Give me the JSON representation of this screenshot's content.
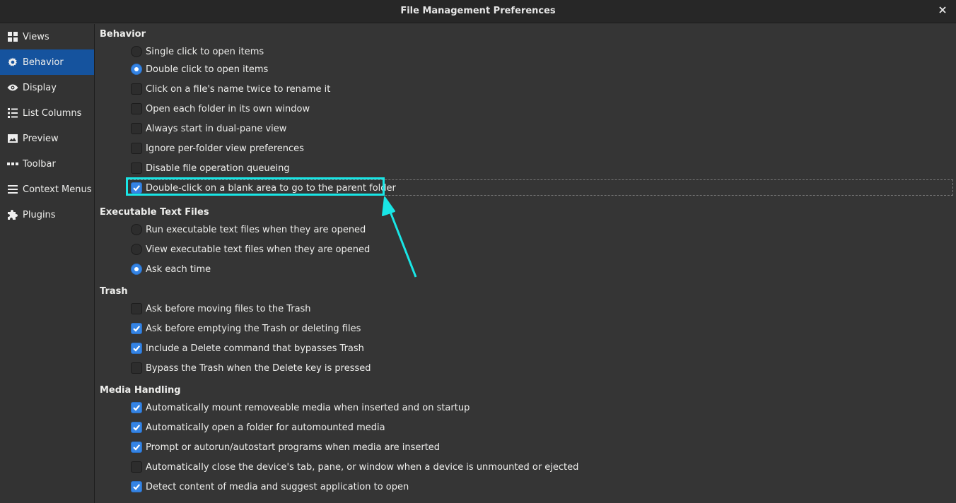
{
  "window": {
    "title": "File Management Preferences",
    "close_icon": "close-icon"
  },
  "sidebar": {
    "items": [
      {
        "label": "Views",
        "icon": "grid-icon",
        "active": false
      },
      {
        "label": "Behavior",
        "icon": "gear-icon",
        "active": true
      },
      {
        "label": "Display",
        "icon": "eye-icon",
        "active": false
      },
      {
        "label": "List Columns",
        "icon": "list-icon",
        "active": false
      },
      {
        "label": "Preview",
        "icon": "image-icon",
        "active": false
      },
      {
        "label": "Toolbar",
        "icon": "dots-icon",
        "active": false
      },
      {
        "label": "Context Menus",
        "icon": "menu-icon",
        "active": false
      },
      {
        "label": "Plugins",
        "icon": "puzzle-icon",
        "active": false
      }
    ]
  },
  "sections": {
    "behavior": {
      "title": "Behavior",
      "options": [
        {
          "type": "radio",
          "label": "Single click to open items",
          "checked": false
        },
        {
          "type": "radio",
          "label": "Double click to open items",
          "checked": true
        },
        {
          "type": "checkbox",
          "label": "Click on a file's name twice to rename it",
          "checked": false
        },
        {
          "type": "checkbox",
          "label": "Open each folder in its own window",
          "checked": false
        },
        {
          "type": "checkbox",
          "label": "Always start in dual-pane view",
          "checked": false
        },
        {
          "type": "checkbox",
          "label": "Ignore per-folder view preferences",
          "checked": false
        },
        {
          "type": "checkbox",
          "label": "Disable file operation queueing",
          "checked": false
        },
        {
          "type": "checkbox",
          "label": "Double-click on a blank area to go to the parent folder",
          "checked": true
        }
      ]
    },
    "executable": {
      "title": "Executable Text Files",
      "options": [
        {
          "type": "radio",
          "label": "Run executable text files when they are opened",
          "checked": false
        },
        {
          "type": "radio",
          "label": "View executable text files when they are opened",
          "checked": false
        },
        {
          "type": "radio",
          "label": "Ask each time",
          "checked": true
        }
      ]
    },
    "trash": {
      "title": "Trash",
      "options": [
        {
          "type": "checkbox",
          "label": "Ask before moving files to the Trash",
          "checked": false
        },
        {
          "type": "checkbox",
          "label": "Ask before emptying the Trash or deleting files",
          "checked": true
        },
        {
          "type": "checkbox",
          "label": "Include a Delete command that bypasses Trash",
          "checked": true
        },
        {
          "type": "checkbox",
          "label": "Bypass the Trash when the Delete key is pressed",
          "checked": false
        }
      ]
    },
    "media": {
      "title": "Media Handling",
      "options": [
        {
          "type": "checkbox",
          "label": "Automatically mount removeable media when inserted and on startup",
          "checked": true
        },
        {
          "type": "checkbox",
          "label": "Automatically open a folder for automounted media",
          "checked": true
        },
        {
          "type": "checkbox",
          "label": "Prompt or autorun/autostart programs when media are inserted",
          "checked": true
        },
        {
          "type": "checkbox",
          "label": "Automatically close the device's tab, pane, or window when a device is unmounted or ejected",
          "checked": false
        },
        {
          "type": "checkbox",
          "label": "Detect content of media and suggest application to open",
          "checked": true
        }
      ]
    }
  },
  "annotation": {
    "highlight_color": "#19e6e6",
    "target": "Double-click on a blank area to go to the parent folder"
  },
  "colors": {
    "accent": "#3584e4",
    "sidebar_active": "#15539e",
    "background": "#353535",
    "titlebar": "#272727"
  }
}
